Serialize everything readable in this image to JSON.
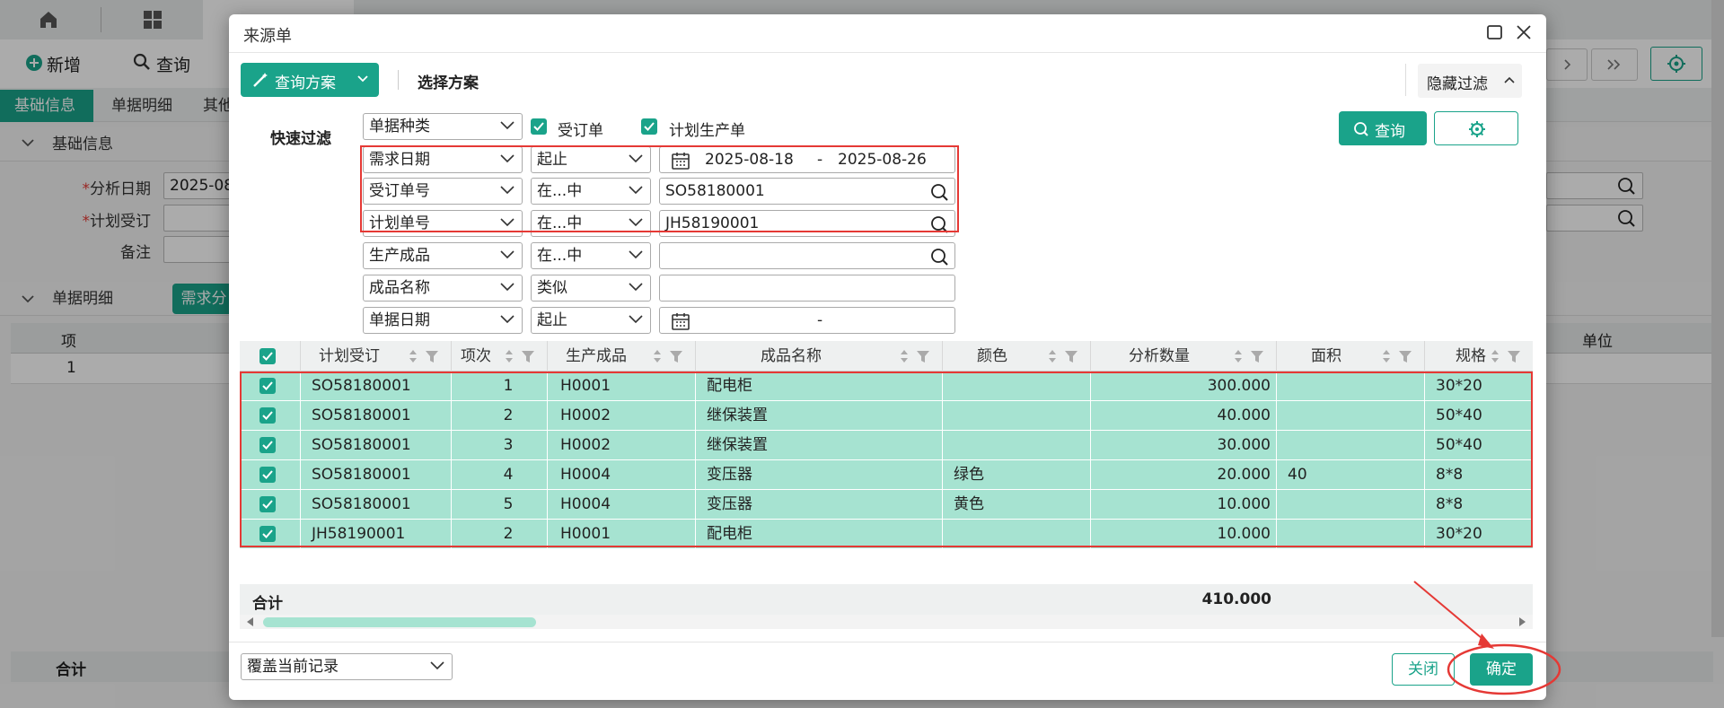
{
  "background": {
    "toolbar": {
      "new_label": "新增",
      "query_label": "查询"
    },
    "tabs": [
      "基础信息",
      "单据明细",
      "其他"
    ],
    "section_basic": "基础信息",
    "fields": [
      {
        "label": "分析日期",
        "required": true,
        "value": "2025-08"
      },
      {
        "label": "计划受订",
        "required": true,
        "value": ""
      },
      {
        "label": "备注",
        "required": false,
        "value": ""
      }
    ],
    "section_detail": "单据明细",
    "detail_button": "需求分",
    "grid_headers": {
      "item": "项",
      "unit": "单位"
    },
    "grid_row_item": "1",
    "total_label": "合计"
  },
  "dialog": {
    "title": "来源单",
    "query_scheme_button": "查询方案",
    "select_scheme_label": "选择方案",
    "hide_filter_button": "隐藏过滤",
    "quick_filter_label": "快速过滤",
    "doc_type_select": "单据种类",
    "doc_type_checks": [
      {
        "label": "受订单",
        "checked": true
      },
      {
        "label": "计划生产单",
        "checked": true
      }
    ],
    "query_button": "查询",
    "filters": [
      {
        "field": "需求日期",
        "op": "起止",
        "kind": "date",
        "from": "2025-08-18",
        "sep": "-",
        "to": "2025-08-26"
      },
      {
        "field": "受订单号",
        "op": "在...中",
        "kind": "search",
        "value": "SO58180001"
      },
      {
        "field": "计划单号",
        "op": "在...中",
        "kind": "search",
        "value": "JH58190001"
      },
      {
        "field": "生产成品",
        "op": "在...中",
        "kind": "search",
        "value": ""
      },
      {
        "field": "成品名称",
        "op": "类似",
        "kind": "text",
        "value": ""
      },
      {
        "field": "单据日期",
        "op": "起止",
        "kind": "date",
        "from": "",
        "sep": "-",
        "to": ""
      }
    ],
    "columns": [
      "计划受订",
      "项次",
      "生产成品",
      "成品名称",
      "颜色",
      "分析数量",
      "面积",
      "规格"
    ],
    "rows": [
      {
        "order": "SO58180001",
        "seq": "1",
        "product": "H0001",
        "name": "配电柜",
        "color": "",
        "qty": "300.000",
        "area": "",
        "spec": "30*20"
      },
      {
        "order": "SO58180001",
        "seq": "2",
        "product": "H0002",
        "name": "继保装置",
        "color": "",
        "qty": "40.000",
        "area": "",
        "spec": "50*40"
      },
      {
        "order": "SO58180001",
        "seq": "3",
        "product": "H0002",
        "name": "继保装置",
        "color": "",
        "qty": "30.000",
        "area": "",
        "spec": "50*40"
      },
      {
        "order": "SO58180001",
        "seq": "4",
        "product": "H0004",
        "name": "变压器",
        "color": "绿色",
        "qty": "20.000",
        "area": "40",
        "spec": "8*8"
      },
      {
        "order": "SO58180001",
        "seq": "5",
        "product": "H0004",
        "name": "变压器",
        "color": "黄色",
        "qty": "10.000",
        "area": "",
        "spec": "8*8"
      },
      {
        "order": "JH58190001",
        "seq": "2",
        "product": "H0001",
        "name": "配电柜",
        "color": "",
        "qty": "10.000",
        "area": "",
        "spec": "30*20"
      }
    ],
    "total_label": "合计",
    "total_qty": "410.000",
    "footer_mode_select": "覆盖当前记录",
    "close_button": "关闭",
    "confirm_button": "确定"
  },
  "colors": {
    "accent": "#1aa38a",
    "row_selected": "#a6e3d1",
    "highlight": "#e53935"
  }
}
